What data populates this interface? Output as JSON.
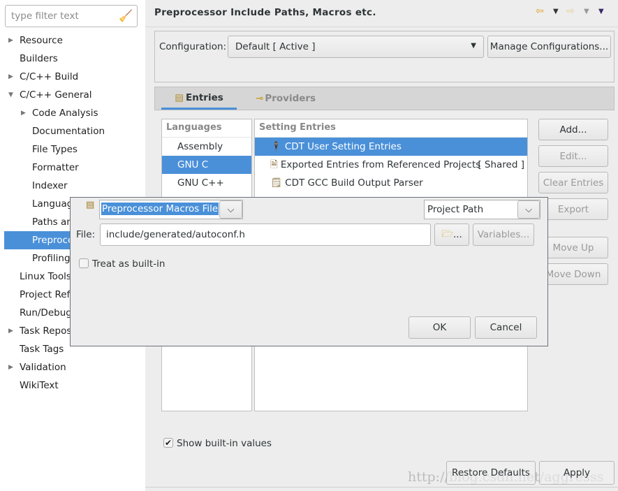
{
  "sidebar": {
    "filter_placeholder": "type filter text",
    "items": [
      {
        "label": "Resource",
        "expander": "collapsed"
      },
      {
        "label": "Builders"
      },
      {
        "label": "C/C++ Build",
        "expander": "collapsed"
      },
      {
        "label": "C/C++ General",
        "expander": "expanded"
      },
      {
        "label": "Code Analysis",
        "expander": "collapsed",
        "child": true
      },
      {
        "label": "Documentation",
        "child": true
      },
      {
        "label": "File Types",
        "child": true
      },
      {
        "label": "Formatter",
        "child": true
      },
      {
        "label": "Indexer",
        "child": true
      },
      {
        "label": "Languag",
        "child": true
      },
      {
        "label": "Paths an",
        "child": true
      },
      {
        "label": "Preproce",
        "child": true,
        "selected": true
      },
      {
        "label": "Profiling",
        "child": true
      },
      {
        "label": "Linux Tools"
      },
      {
        "label": "Project Ref"
      },
      {
        "label": "Run/Debug"
      },
      {
        "label": "Task Repos",
        "expander": "collapsed"
      },
      {
        "label": "Task Tags"
      },
      {
        "label": "Validation",
        "expander": "collapsed"
      },
      {
        "label": "WikiText"
      }
    ]
  },
  "header": {
    "title": "Preprocessor Include Paths, Macros etc."
  },
  "config": {
    "label": "Configuration:",
    "value": "Default  [ Active ]",
    "manage": "Manage Configurations..."
  },
  "tabs": [
    {
      "label": "Entries",
      "active": true
    },
    {
      "label": "Providers"
    }
  ],
  "languages": {
    "header": "Languages",
    "items": [
      "Assembly",
      "GNU C",
      "GNU C++"
    ],
    "selected": "GNU C"
  },
  "entries": {
    "header": "Setting Entries",
    "items": [
      {
        "label": "CDT User Setting Entries",
        "selected": true
      },
      {
        "label": "Exported Entries from Referenced Projects",
        "badge": "[ Shared ]"
      },
      {
        "label": "CDT GCC Build Output Parser"
      }
    ]
  },
  "side_buttons": {
    "add": "Add...",
    "edit": "Edit...",
    "clear": "Clear Entries",
    "export": "Export",
    "move_up": "Move Up",
    "move_down": "Move Down"
  },
  "dialog": {
    "kind": "Preprocessor Macros File",
    "path_type": "Project Path",
    "file_label": "File:",
    "file_value": "include/generated/autoconf.h",
    "browse": "...",
    "variables": "Variables...",
    "builtin_label": "Treat as built-in",
    "builtin_checked": false,
    "ok": "OK",
    "cancel": "Cancel"
  },
  "show_builtin": {
    "label": "Show built-in values",
    "checked": true
  },
  "footer": {
    "restore": "Restore Defaults",
    "apply": "Apply"
  },
  "watermark": "http://blog.csdn.net/aggresss",
  "colors": {
    "selection": "#4a90d9"
  }
}
